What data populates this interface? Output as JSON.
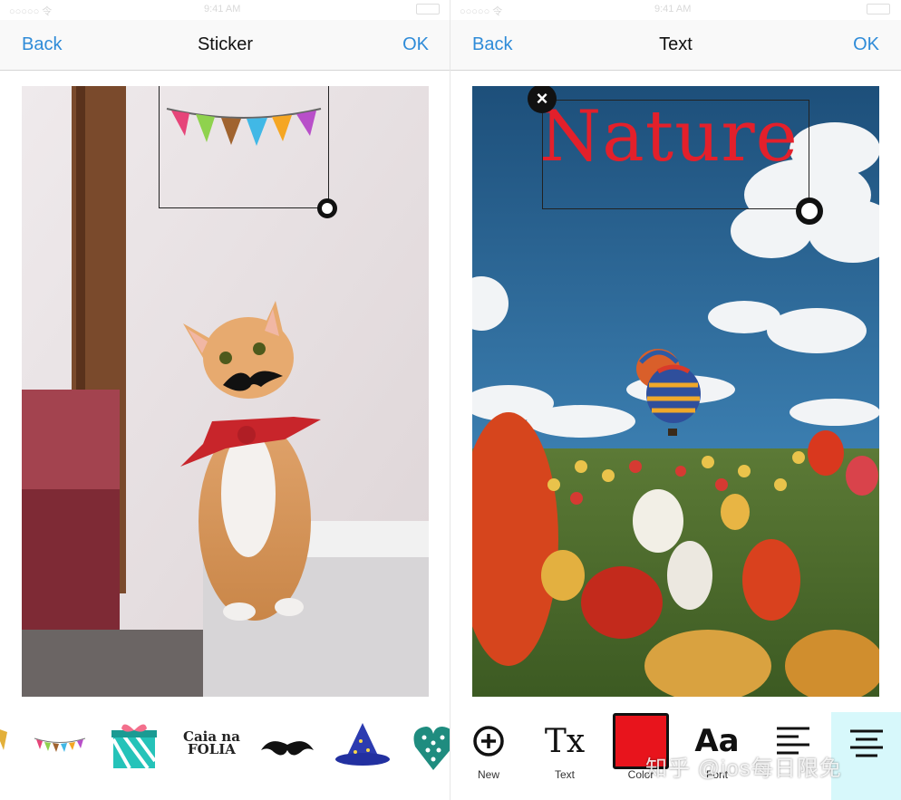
{
  "left": {
    "status": {
      "carrier": "○○○○○ 令",
      "time": "9:41 AM"
    },
    "nav": {
      "back": "Back",
      "title": "Sticker",
      "ok": "OK"
    },
    "stickers": [
      {
        "name": "banner-sticker"
      },
      {
        "name": "gift-sticker"
      },
      {
        "name": "caia-na-folia-sticker",
        "text": "Caia na\nFOLIA"
      },
      {
        "name": "mustache-sticker"
      },
      {
        "name": "wizard-hat-sticker"
      },
      {
        "name": "heart-sticker"
      }
    ]
  },
  "right": {
    "status": {
      "carrier": "○○○○○ 令",
      "time": "9:41 AM"
    },
    "nav": {
      "back": "Back",
      "title": "Text",
      "ok": "OK"
    },
    "overlay_text": "Nature",
    "overlay_color": "#e3202b",
    "tools": [
      {
        "name": "new",
        "label": "New",
        "icon": "plus-circle-icon"
      },
      {
        "name": "text",
        "label": "Text",
        "icon": "tx-icon",
        "glyph": "Tx"
      },
      {
        "name": "color",
        "label": "Color",
        "icon": "color-swatch-icon",
        "color": "#e8141c"
      },
      {
        "name": "font",
        "label": "Font",
        "icon": "font-aa-icon",
        "glyph": "Aa"
      },
      {
        "name": "align-left",
        "label": "",
        "icon": "align-left-icon"
      },
      {
        "name": "align-center",
        "label": "",
        "icon": "align-center-icon",
        "active": true
      }
    ]
  },
  "watermark": "知乎 @ios每日限免",
  "colors": {
    "accent": "#2e8bd8",
    "active_tool_bg": "#d7f8fb"
  }
}
